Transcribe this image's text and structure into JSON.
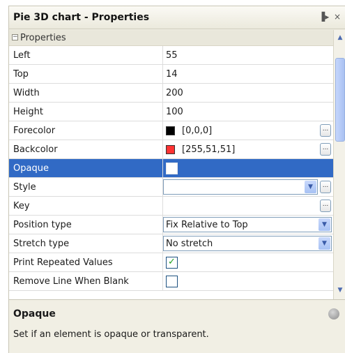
{
  "window": {
    "title": "Pie 3D chart - Properties"
  },
  "titlebar_buttons": {
    "pin": "▐▸",
    "close": "×"
  },
  "category": {
    "expander": "−",
    "label": "Properties"
  },
  "rows": [
    {
      "name": "Left",
      "value": "55"
    },
    {
      "name": "Top",
      "value": "14"
    },
    {
      "name": "Width",
      "value": "200"
    },
    {
      "name": "Height",
      "value": "100"
    },
    {
      "name": "Forecolor",
      "value": "[0,0,0]",
      "color": "#000000"
    },
    {
      "name": "Backcolor",
      "value": "[255,51,51]",
      "color": "#ff3333"
    },
    {
      "name": "Opaque",
      "value": ""
    },
    {
      "name": "Style",
      "value": ""
    },
    {
      "name": "Key",
      "value": ""
    },
    {
      "name": "Position type",
      "value": "Fix Relative to Top"
    },
    {
      "name": "Stretch type",
      "value": "No stretch"
    },
    {
      "name": "Print Repeated Values",
      "value": "✓"
    },
    {
      "name": "Remove Line When Blank",
      "value": ""
    }
  ],
  "ellipsis_label": "...",
  "help": {
    "title": "Opaque",
    "text": "Set if an element is opaque or transparent."
  },
  "colors": {
    "selection": "#316ac5",
    "panel": "#f1efe4"
  }
}
